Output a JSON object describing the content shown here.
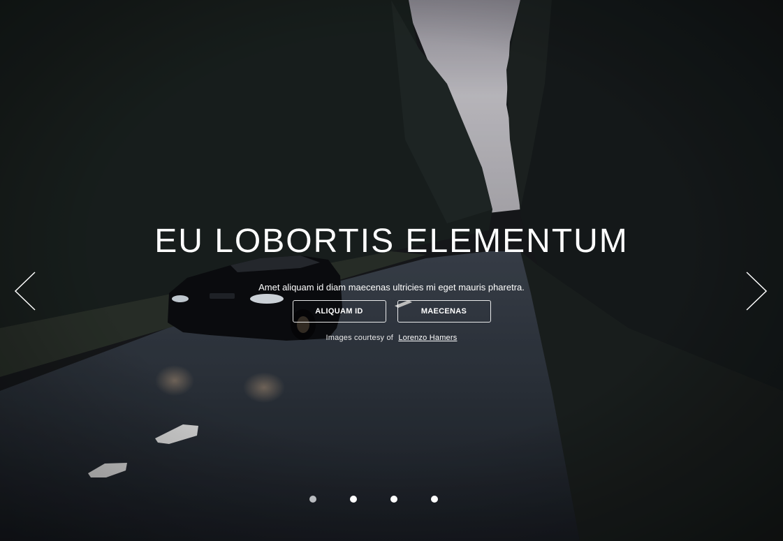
{
  "hero": {
    "title": "EU LOBORTIS ELEMENTUM",
    "subtitle": "Amet aliquam id diam maecenas ultricies mi eget mauris pharetra.",
    "buttons": [
      {
        "label": "ALIQUAM ID"
      },
      {
        "label": "MAECENAS"
      }
    ],
    "credit_prefix": "Images courtesy of",
    "credit_link": "Lorenzo Hamers"
  },
  "carousel": {
    "prev_icon": "chevron-left-icon",
    "next_icon": "chevron-right-icon",
    "slide_count": 4,
    "active_slide": 1
  },
  "colors": {
    "text": "#ffffff",
    "background": "#17181b",
    "dot_active": "#b9bcc0",
    "dot_inactive": "#ffffff"
  }
}
